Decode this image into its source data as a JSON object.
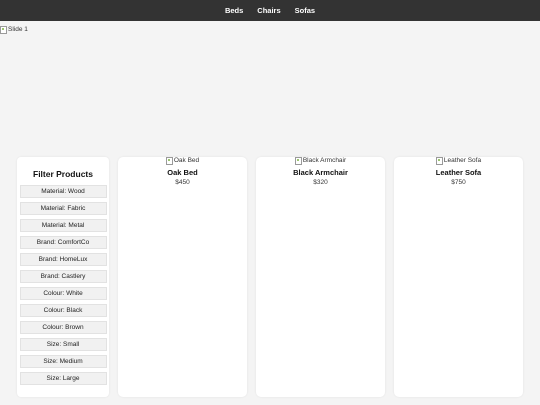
{
  "nav": {
    "items": [
      {
        "label": "Beds"
      },
      {
        "label": "Chairs"
      },
      {
        "label": "Sofas"
      }
    ]
  },
  "slider": {
    "image_alt": "Slide 1"
  },
  "filters": {
    "title": "Filter Products",
    "options": [
      {
        "label": "Material: Wood"
      },
      {
        "label": "Material: Fabric"
      },
      {
        "label": "Material: Metal"
      },
      {
        "label": "Brand: ComfortCo"
      },
      {
        "label": "Brand: HomeLux"
      },
      {
        "label": "Brand: Castlery"
      },
      {
        "label": "Colour: White"
      },
      {
        "label": "Colour: Black"
      },
      {
        "label": "Colour: Brown"
      },
      {
        "label": "Size: Small"
      },
      {
        "label": "Size: Medium"
      },
      {
        "label": "Size: Large"
      }
    ]
  },
  "products": [
    {
      "image_alt": "Oak Bed",
      "name": "Oak Bed",
      "price": "$450"
    },
    {
      "image_alt": "Black Armchair",
      "name": "Black Armchair",
      "price": "$320"
    },
    {
      "image_alt": "Leather Sofa",
      "name": "Leather Sofa",
      "price": "$750"
    }
  ],
  "colors": {
    "nav_background": "#333333",
    "page_background": "#f4f4f4",
    "card_background": "#ffffff",
    "filter_button_background": "#f1f1f1"
  }
}
